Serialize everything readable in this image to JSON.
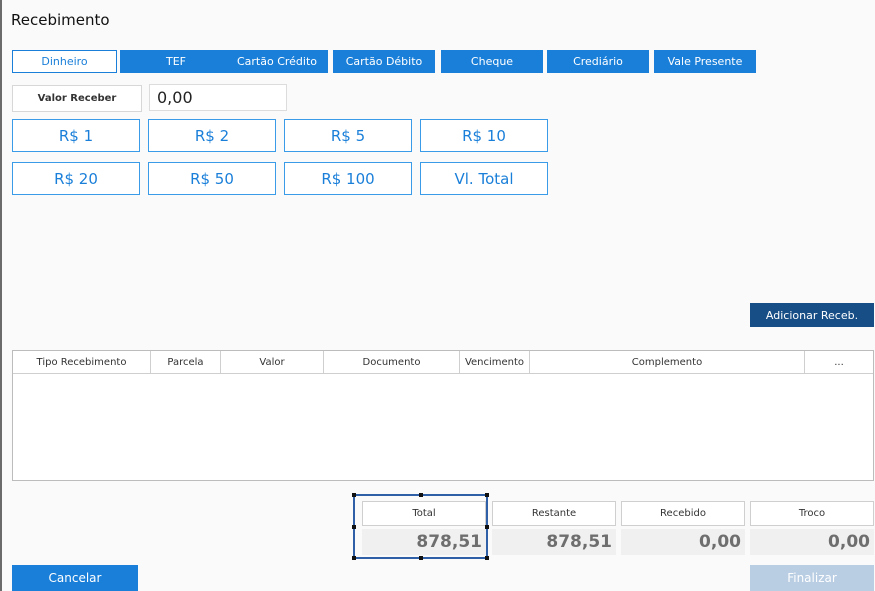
{
  "title": "Recebimento",
  "tabs": [
    {
      "label": "Dinheiro",
      "active": true
    },
    {
      "label": "TEF",
      "active": false
    },
    {
      "label": "Cartão Crédito",
      "active": false
    },
    {
      "label": "Cartão Débito",
      "active": false
    },
    {
      "label": "Cheque",
      "active": false
    },
    {
      "label": "Crediário",
      "active": false
    },
    {
      "label": "Vale Presente",
      "active": false
    }
  ],
  "valor_receber": {
    "label": "Valor Receber",
    "value": "0,00"
  },
  "quick_buttons": [
    "R$ 1",
    "R$ 2",
    "R$ 5",
    "R$ 10",
    "R$ 20",
    "R$ 50",
    "R$ 100",
    "Vl. Total"
  ],
  "add_button": "Adicionar Receb.",
  "grid": {
    "columns": [
      "Tipo Recebimento",
      "Parcela",
      "Valor",
      "Documento",
      "Vencimento",
      "Complemento",
      "..."
    ]
  },
  "summary": {
    "total": {
      "label": "Total",
      "value": "878,51"
    },
    "restante": {
      "label": "Restante",
      "value": "878,51"
    },
    "recebido": {
      "label": "Recebido",
      "value": "0,00"
    },
    "troco": {
      "label": "Troco",
      "value": "0,00"
    }
  },
  "footer": {
    "cancel": "Cancelar",
    "finalize": "Finalizar"
  },
  "colors": {
    "accent": "#1a7fd9",
    "dark_accent": "#174e86",
    "disabled": "#b9cde3"
  }
}
